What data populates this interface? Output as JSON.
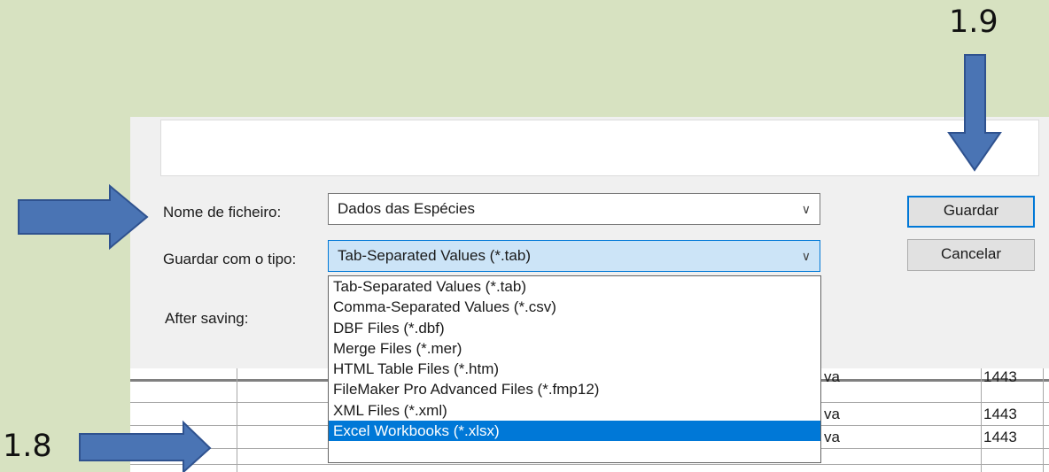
{
  "annotations": {
    "step_top": "1.9",
    "step_left": "1.8"
  },
  "dialog": {
    "filename_label": "Nome de ficheiro:",
    "filename_value": "Dados das Espécies",
    "filetype_label": "Guardar com o tipo:",
    "filetype_value": "Tab-Separated Values (*.tab)",
    "after_saving_label": "After saving:",
    "save_button": "Guardar",
    "cancel_button": "Cancelar",
    "dropdown_options": [
      "Tab-Separated Values (*.tab)",
      "Comma-Separated Values (*.csv)",
      "DBF Files (*.dbf)",
      "Merge Files (*.mer)",
      "HTML Table Files (*.htm)",
      "FileMaker Pro Advanced Files (*.fmp12)",
      "XML Files (*.xml)",
      "Excel Workbooks (*.xlsx)"
    ],
    "highlighted_option": "Excel Workbooks (*.xlsx)"
  },
  "sheet": {
    "rows": [
      {
        "col_a": "va",
        "col_b": "1443"
      },
      {
        "col_a": "va",
        "col_b": "1443"
      },
      {
        "col_a": "va",
        "col_b": "1443"
      }
    ]
  },
  "colors": {
    "arrow": "#4a74b4",
    "highlight": "#0078d7",
    "background": "#d7e2c1"
  },
  "icons": [
    "arrow-down-icon",
    "arrow-right-icon",
    "chevron-down-icon"
  ]
}
